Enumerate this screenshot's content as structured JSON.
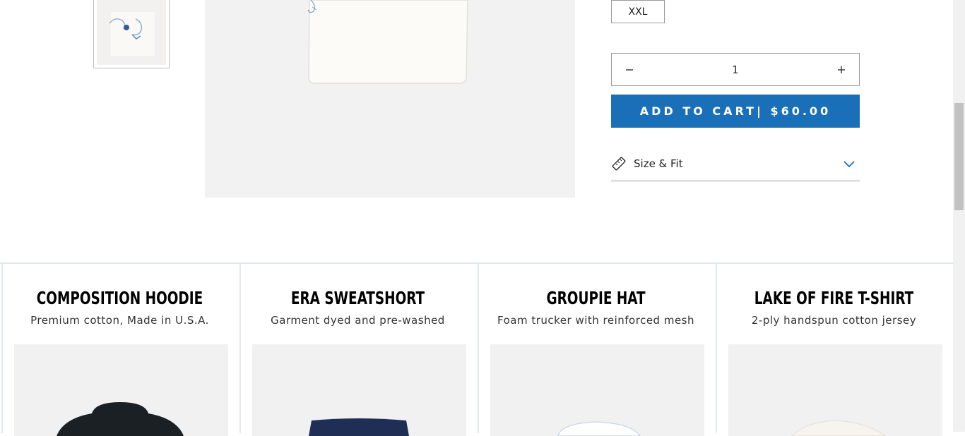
{
  "product": {
    "size_option": "XXL",
    "quantity": "1",
    "add_to_cart": "ADD TO CART| $60.00",
    "size_fit_label": "Size & Fit"
  },
  "colors": {
    "accent": "#1a6fb9",
    "border": "#9a9a9a"
  },
  "related": [
    {
      "title": "COMPOSITION HOODIE",
      "subtitle": "Premium cotton, Made in U.S.A."
    },
    {
      "title": "ERA SWEATSHORT",
      "subtitle": "Garment dyed and pre-washed"
    },
    {
      "title": "GROUPIE HAT",
      "subtitle": "Foam trucker with reinforced mesh"
    },
    {
      "title": "LAKE OF FIRE T-SHIRT",
      "subtitle": "2-ply handspun cotton jersey"
    }
  ]
}
